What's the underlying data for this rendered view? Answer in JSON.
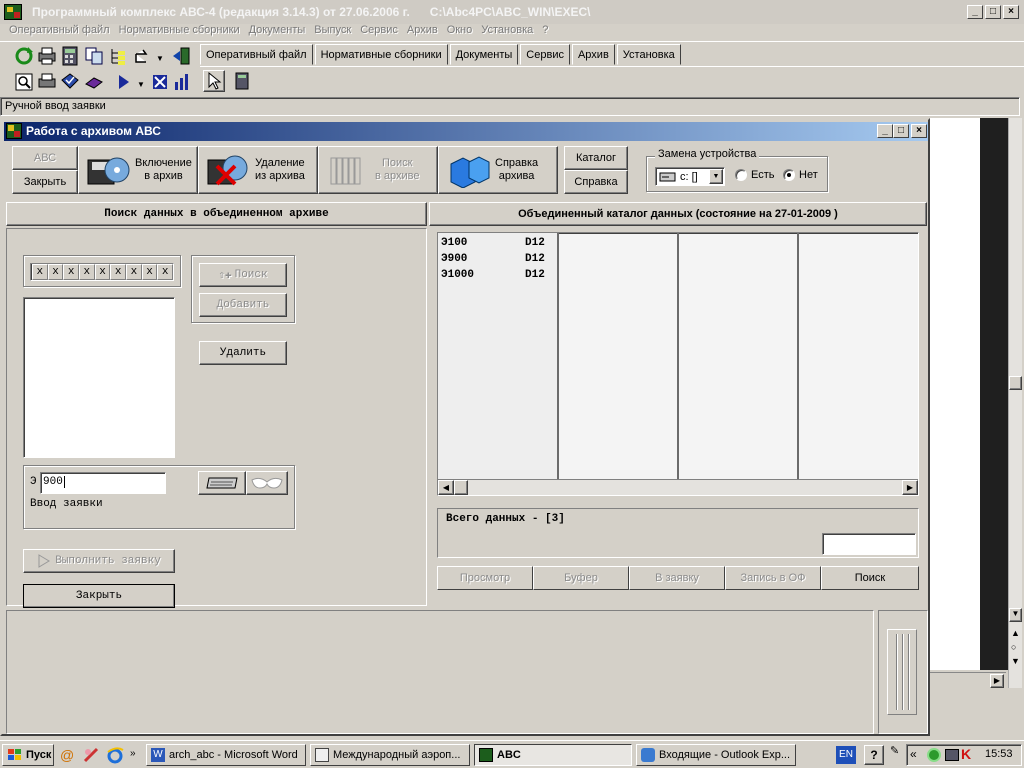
{
  "main_window": {
    "title": "Программный комплекс АВС-4 (редакция 3.14.3) от 27.06.2006 г.      C:\\Abc4PC\\ABC_WIN\\EXEC\\",
    "menu": [
      "Оперативный файл",
      "Нормативные сборники",
      "Документы",
      "Выпуск",
      "Сервис",
      "Архив",
      "Окно",
      "Установка",
      "?"
    ],
    "tabs": [
      "Оперативный файл",
      "Нормативные сборники",
      "Документы",
      "Сервис",
      "Архив",
      "Установка"
    ],
    "active_tab": "Архив",
    "status_text": "Ручной ввод заявки"
  },
  "archive_window": {
    "title": "Работа с архивом АВС",
    "toolbar": {
      "abc_label": "АВС",
      "close_label": "Закрыть",
      "include_line1": "Включение",
      "include_line2": "в архив",
      "delete_line1": "Удаление",
      "delete_line2": "из архива",
      "search_line1": "Поиск",
      "search_line2": "в архиве",
      "help_line1": "Справка",
      "help_line2": "архива",
      "catalog_label": "Каталог",
      "help_label": "Справка"
    },
    "device_group": {
      "legend": "Замена устройства",
      "drive_value": "c: []",
      "option_yes": "Есть",
      "option_no": "Нет",
      "selected": "Нет"
    },
    "left_panel": {
      "header": "Поиск данных в объединенном архиве",
      "mask_chars": [
        "x",
        "x",
        "x",
        "x",
        "x",
        "x",
        "x",
        "x",
        "x"
      ],
      "search_button": "Поиск",
      "add_button": "Добавить",
      "delete_button": "Удалить",
      "prefix": "Э",
      "input_value": "900",
      "input_label": "Ввод заявки",
      "execute_button": "Выполнить заявку",
      "close_button": "Закрыть"
    },
    "right_panel": {
      "header": "Объединенный каталог данных (состояние на 27-01-2009 )",
      "rows": [
        {
          "code": "Э100",
          "type": "D12"
        },
        {
          "code": "Э900",
          "type": "D12"
        },
        {
          "code": "Э1000",
          "type": "D12"
        }
      ],
      "total_text": "Всего данных - [3]",
      "buttons": [
        "Просмотр",
        "Буфер",
        "В заявку",
        "Запись в ОФ",
        "Поиск"
      ]
    }
  },
  "taskbar": {
    "start_label": "Пуск",
    "tasks": [
      "arch_abc - Microsoft Word",
      "Международный аэроп...",
      "ABC",
      "Входящие - Outlook Exp..."
    ],
    "active_task": "ABC",
    "lang": "EN",
    "time": "15:53"
  }
}
